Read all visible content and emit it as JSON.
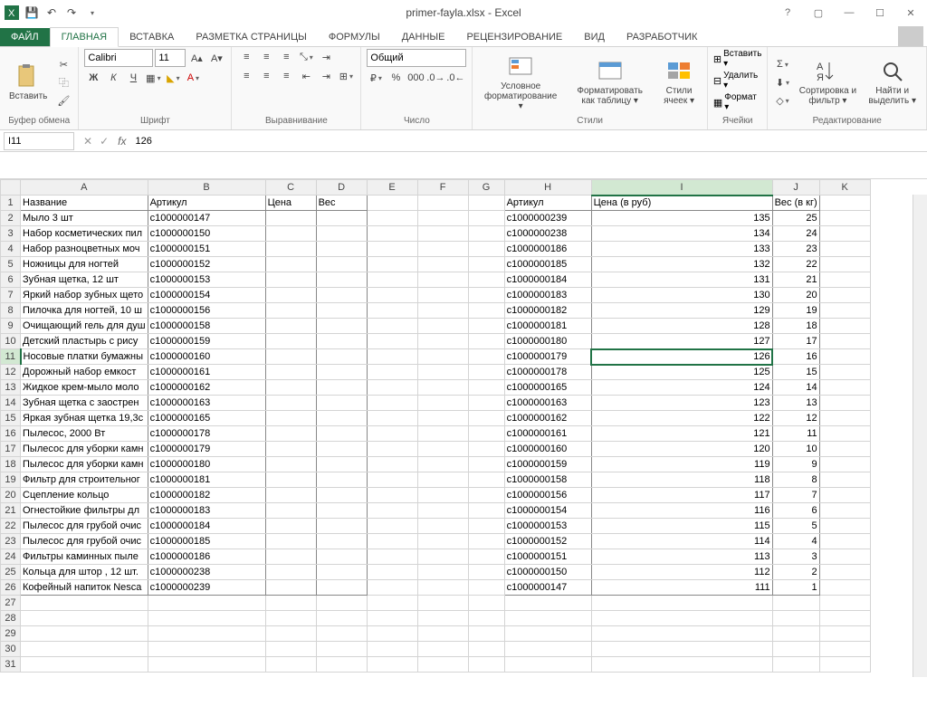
{
  "title": "primer-fayla.xlsx - Excel",
  "tabs": {
    "file": "ФАЙЛ",
    "home": "ГЛАВНАЯ",
    "insert": "ВСТАВКА",
    "layout": "РАЗМЕТКА СТРАНИЦЫ",
    "formulas": "ФОРМУЛЫ",
    "data": "ДАННЫЕ",
    "review": "РЕЦЕНЗИРОВАНИЕ",
    "view": "ВИД",
    "developer": "РАЗРАБОТЧИК"
  },
  "ribbon": {
    "paste": "Вставить",
    "clipboard": "Буфер обмена",
    "font_name": "Calibri",
    "font_size": "11",
    "font_group": "Шрифт",
    "align_group": "Выравнивание",
    "num_format": "Общий",
    "number_group": "Число",
    "cond_fmt": "Условное форматирование ▾",
    "tbl_fmt": "Форматировать как таблицу ▾",
    "cell_styles": "Стили ячеек ▾",
    "styles_group": "Стили",
    "insert_btn": "Вставить ▾",
    "delete_btn": "Удалить ▾",
    "format_btn": "Формат ▾",
    "cells_group": "Ячейки",
    "sort": "Сортировка и фильтр ▾",
    "find": "Найти и выделить ▾",
    "edit_group": "Редактирование"
  },
  "name_box": "I11",
  "formula": "126",
  "cols": {
    "A": 140,
    "B": 130,
    "C": 56,
    "D": 56,
    "E": 56,
    "F": 56,
    "G": 40,
    "H": 96,
    "I": 200,
    "J": 48,
    "K": 56
  },
  "headers": {
    "A": "Название",
    "B": "Артикул",
    "C": "Цена",
    "D": "Вес",
    "H": "Артикул",
    "I": "Цена (в руб)",
    "J": "Вес (в кг)"
  },
  "left_rows": [
    [
      "Мыло 3 шт",
      "с1000000147"
    ],
    [
      "Набор косметических пил",
      "с1000000150"
    ],
    [
      "Набор разноцветных моч",
      "с1000000151"
    ],
    [
      "Ножницы для ногтей",
      "с1000000152"
    ],
    [
      "Зубная щетка, 12 шт",
      "с1000000153"
    ],
    [
      "Яркий набор зубных щето",
      "с1000000154"
    ],
    [
      "Пилочка для ногтей, 10 ш",
      "с1000000156"
    ],
    [
      "Очищающий гель для душ",
      "с1000000158"
    ],
    [
      "Детский пластырь с рису",
      "с1000000159"
    ],
    [
      "Носовые платки бумажны",
      "с1000000160"
    ],
    [
      "Дорожный набор емкост",
      "с1000000161"
    ],
    [
      "Жидкое крем-мыло моло",
      "с1000000162"
    ],
    [
      "Зубная щетка с заострен",
      "с1000000163"
    ],
    [
      "Яркая зубная щетка 19,3с",
      "с1000000165"
    ],
    [
      "Пылесос, 2000 Вт",
      "с1000000178"
    ],
    [
      "Пылесос для уборки камн",
      "с1000000179"
    ],
    [
      "Пылесос для уборки камн",
      "с1000000180"
    ],
    [
      "Фильтр для строительног",
      "с1000000181"
    ],
    [
      "Сцепление кольцо",
      "с1000000182"
    ],
    [
      "Огнестойкие фильтры дл",
      "с1000000183"
    ],
    [
      "Пылесос для грубой очис",
      "с1000000184"
    ],
    [
      "Пылесос для грубой очис",
      "с1000000185"
    ],
    [
      "Фильтры каминных пыле",
      "с1000000186"
    ],
    [
      "Кольца для штор , 12 шт.",
      "с1000000238"
    ],
    [
      "Кофейный напиток Nesca",
      "с1000000239"
    ]
  ],
  "right_rows": [
    [
      "с1000000239",
      135,
      25
    ],
    [
      "с1000000238",
      134,
      24
    ],
    [
      "с1000000186",
      133,
      23
    ],
    [
      "с1000000185",
      132,
      22
    ],
    [
      "с1000000184",
      131,
      21
    ],
    [
      "с1000000183",
      130,
      20
    ],
    [
      "с1000000182",
      129,
      19
    ],
    [
      "с1000000181",
      128,
      18
    ],
    [
      "с1000000180",
      127,
      17
    ],
    [
      "с1000000179",
      126,
      16
    ],
    [
      "с1000000178",
      125,
      15
    ],
    [
      "с1000000165",
      124,
      14
    ],
    [
      "с1000000163",
      123,
      13
    ],
    [
      "с1000000162",
      122,
      12
    ],
    [
      "с1000000161",
      121,
      11
    ],
    [
      "с1000000160",
      120,
      10
    ],
    [
      "с1000000159",
      119,
      9
    ],
    [
      "с1000000158",
      118,
      8
    ],
    [
      "с1000000156",
      117,
      7
    ],
    [
      "с1000000154",
      116,
      6
    ],
    [
      "с1000000153",
      115,
      5
    ],
    [
      "с1000000152",
      114,
      4
    ],
    [
      "с1000000151",
      113,
      3
    ],
    [
      "с1000000150",
      112,
      2
    ],
    [
      "с1000000147",
      111,
      1
    ]
  ],
  "selected": {
    "row": 11,
    "col": "I"
  }
}
